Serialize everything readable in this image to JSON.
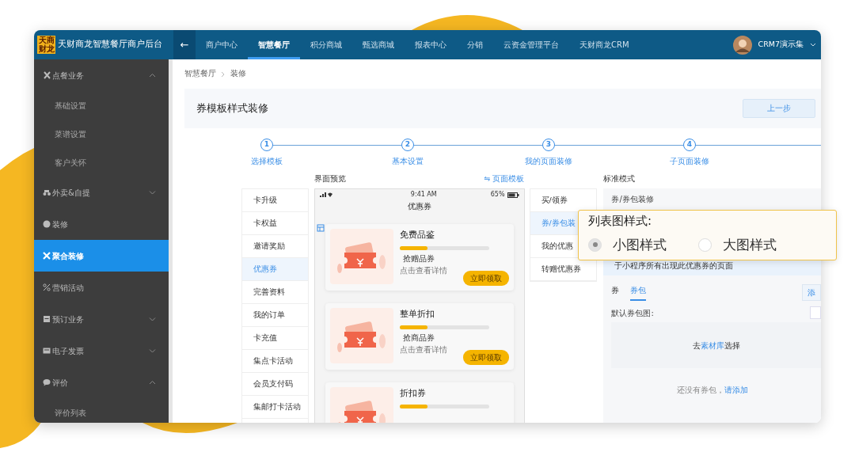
{
  "app": {
    "logo": "天商财龙",
    "title": "天财商龙智慧餐厅商户后台",
    "back": "←"
  },
  "nav": [
    {
      "label": "商户中心",
      "selected": false
    },
    {
      "label": "智慧餐厅",
      "selected": true
    },
    {
      "label": "积分商城",
      "selected": false
    },
    {
      "label": "甄选商城",
      "selected": false
    },
    {
      "label": "报表中心",
      "selected": false
    },
    {
      "label": "分销",
      "selected": false
    },
    {
      "label": "云资金管理平台",
      "selected": false
    },
    {
      "label": "天财商龙CRM",
      "selected": false
    }
  ],
  "user": {
    "name": "CRM7演示集"
  },
  "sidebar": [
    {
      "label": "点餐业务",
      "expanded": true,
      "selected": false,
      "children": [
        {
          "label": "基础设置"
        },
        {
          "label": "菜谱设置"
        },
        {
          "label": "客户关怀"
        }
      ]
    },
    {
      "label": "外卖&自提",
      "expanded": false,
      "selected": false
    },
    {
      "label": "装修",
      "selected": false
    },
    {
      "label": "聚合装修",
      "selected": true
    },
    {
      "label": "营销活动",
      "selected": false
    },
    {
      "label": "预订业务",
      "expanded": false,
      "selected": false
    },
    {
      "label": "电子发票",
      "expanded": false,
      "selected": false
    },
    {
      "label": "评价",
      "expanded": true,
      "selected": false,
      "children": [
        {
          "label": "评价列表"
        }
      ]
    }
  ],
  "breadcrumb": [
    "智慧餐厅",
    "装修"
  ],
  "page": {
    "title": "券模板样式装修",
    "back_button": "上一步"
  },
  "steps": [
    {
      "number": "1",
      "label": "选择模板"
    },
    {
      "number": "2",
      "label": "基本设置"
    },
    {
      "number": "3",
      "label": "我的页面装修"
    },
    {
      "number": "4",
      "label": "子页面装修"
    }
  ],
  "preview": {
    "label": "界面预览",
    "template_link": "⇋ 页面模板",
    "menu": [
      {
        "label": "卡升级",
        "selected": false
      },
      {
        "label": "卡权益",
        "selected": false
      },
      {
        "label": "邀请奖励",
        "selected": false
      },
      {
        "label": "优惠券",
        "selected": true
      },
      {
        "label": "完善资料",
        "selected": false
      },
      {
        "label": "我的订单",
        "selected": false
      },
      {
        "label": "卡充值",
        "selected": false
      },
      {
        "label": "集点卡活动",
        "selected": false
      },
      {
        "label": "会员支付码",
        "selected": false
      },
      {
        "label": "集邮打卡活动",
        "selected": false
      }
    ],
    "phone": {
      "time": "9:41 AM",
      "battery": "65%",
      "title": "优惠券",
      "coupons": [
        {
          "title": "免费品鉴",
          "level": 0.31,
          "type": "抢赠品券",
          "hint": "点击查看详情",
          "button": "立即领取"
        },
        {
          "title": "整单折扣",
          "level": 0.31,
          "type": "抢商品券",
          "hint": "点击查看详情",
          "button": "立即领取"
        },
        {
          "title": "折扣券",
          "level": 0.31
        }
      ]
    }
  },
  "coupon_menu": [
    {
      "label": "买/领券",
      "selected": false
    },
    {
      "label": "券/券包装",
      "selected": true
    },
    {
      "label": "我的优惠",
      "selected": false
    },
    {
      "label": "转赠优惠券",
      "selected": false
    }
  ],
  "settings": {
    "mode_label": "标准模式",
    "heading": "券/券包装修",
    "notice": "于小程序所有出现此优惠券的页面",
    "tabs": [
      {
        "label": "券",
        "selected": false
      },
      {
        "label": "券包",
        "selected": true
      }
    ],
    "add_button": "添",
    "image_label": "默认券包图:",
    "upload": {
      "before": "去",
      "link": "素材库",
      "after": "选择"
    },
    "empty": {
      "text": "还没有券包，",
      "link": "请添加"
    }
  },
  "popup": {
    "title": "列表图样式:",
    "options": [
      {
        "label": "小图样式",
        "selected": true
      },
      {
        "label": "大图样式",
        "selected": false
      }
    ]
  }
}
